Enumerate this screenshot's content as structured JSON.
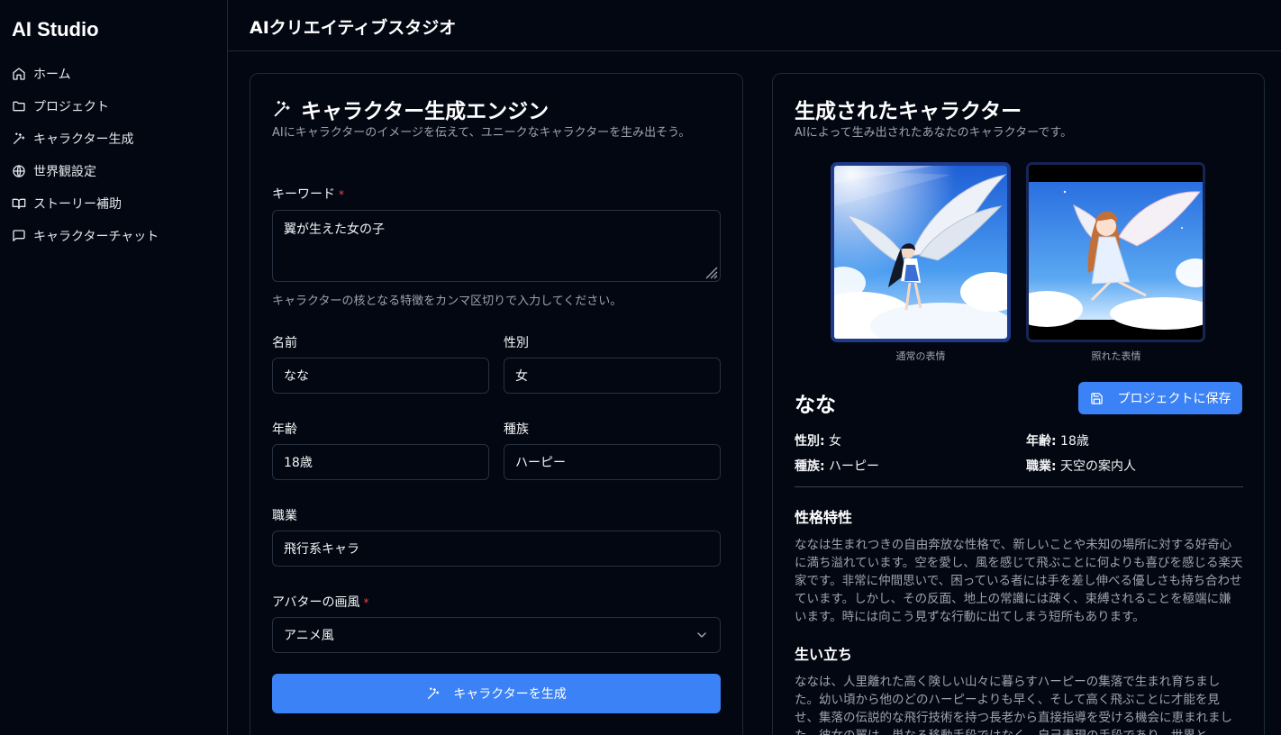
{
  "app": {
    "brand": "AI Studio",
    "page_title": "AIクリエイティブスタジオ"
  },
  "sidebar": {
    "items": [
      {
        "label": "ホーム",
        "icon": "home-icon"
      },
      {
        "label": "プロジェクト",
        "icon": "folder-icon"
      },
      {
        "label": "キャラクター生成",
        "icon": "magic-wand-icon"
      },
      {
        "label": "世界観設定",
        "icon": "globe-icon"
      },
      {
        "label": "ストーリー補助",
        "icon": "book-icon"
      },
      {
        "label": "キャラクターチャット",
        "icon": "chat-bubble-icon"
      }
    ]
  },
  "generator": {
    "title": "キャラクター生成エンジン",
    "description": "AIにキャラクターのイメージを伝えて、ユニークなキャラクターを生み出そう。",
    "keyword": {
      "label": "キーワード",
      "required_mark": "*",
      "value": "翼が生えた女の子",
      "hint": "キャラクターの核となる特徴をカンマ区切りで入力してください。"
    },
    "name": {
      "label": "名前",
      "value": "なな"
    },
    "gender": {
      "label": "性別",
      "value": "女"
    },
    "age": {
      "label": "年齢",
      "value": "18歳"
    },
    "race": {
      "label": "種族",
      "value": "ハーピー"
    },
    "job": {
      "label": "職業",
      "value": "飛行系キャラ"
    },
    "style": {
      "label": "アバターの画風",
      "required_mark": "*",
      "value": "アニメ風"
    },
    "submit_label": "キャラクターを生成"
  },
  "result": {
    "title": "生成されたキャラクター",
    "description": "AIによって生み出されたあなたのキャラクターです。",
    "avatars": [
      {
        "caption": "通常の表情"
      },
      {
        "caption": "照れた表情"
      }
    ],
    "name": "なな",
    "save_label": "プロジェクトに保存",
    "attributes": {
      "gender": {
        "key": "性別:",
        "value": " 女"
      },
      "age": {
        "key": "年齢:",
        "value": " 18歳"
      },
      "race": {
        "key": "種族:",
        "value": " ハーピー"
      },
      "job": {
        "key": "職業:",
        "value": " 天空の案内人"
      }
    },
    "personality": {
      "title": "性格特性",
      "text": "ななは生まれつきの自由奔放な性格で、新しいことや未知の場所に対する好奇心に満ち溢れています。空を愛し、風を感じて飛ぶことに何よりも喜びを感じる楽天家です。非常に仲間思いで、困っている者には手を差し伸べる優しさも持ち合わせています。しかし、その反面、地上の常識には疎く、束縛されることを極端に嫌います。時には向こう見ずな行動に出てしまう短所もあります。"
    },
    "background": {
      "title": "生い立ち",
      "text": "ななは、人里離れた高く険しい山々に暮らすハーピーの集落で生まれ育ちました。幼い頃から他のどのハーピーよりも早く、そして高く飛ぶことに才能を見せ、集落の伝説的な飛行技術を持つ長老から直接指導を受ける機会に恵まれました。彼女の翼は、単なる移動手段ではなく、自己表現の手段であり、世界と"
    }
  },
  "colors": {
    "accent": "#3b82f6",
    "background": "#030712",
    "border": "#1f2937",
    "required": "#ef4444"
  }
}
